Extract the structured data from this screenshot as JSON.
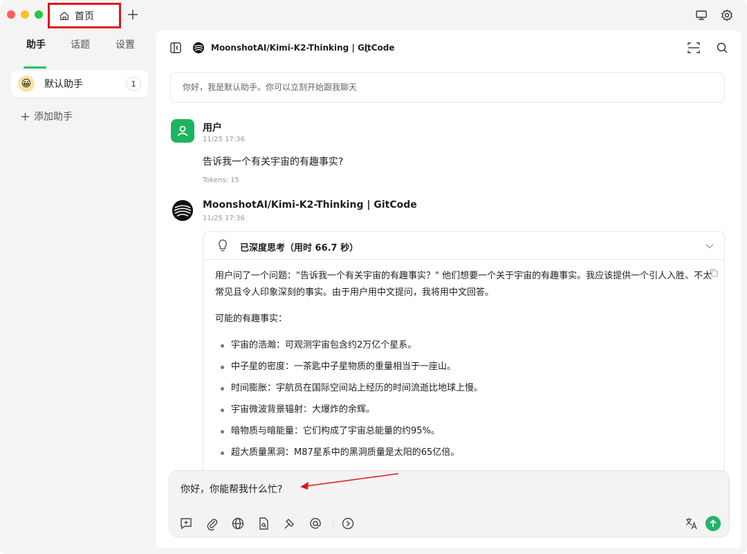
{
  "titlebar": {
    "tab_label": "首页",
    "icons": [
      "home-icon",
      "plus-icon",
      "monitor-icon",
      "gear-icon"
    ]
  },
  "sidebar": {
    "tabs": [
      {
        "label": "助手",
        "active": true
      },
      {
        "label": "话题",
        "active": false
      },
      {
        "label": "设置",
        "active": false
      }
    ],
    "assistant": {
      "emoji": "😀",
      "name": "默认助手",
      "count": "1"
    },
    "add_label": "添加助手"
  },
  "main": {
    "model_title": "MoonshotAI/Kimi-K2-Thinking | GitCode",
    "notice": "你好，我是默认助手。你可以立刻开始跟我聊天"
  },
  "messages": {
    "user": {
      "name": "用户",
      "time": "11/25 17:36",
      "text": "告诉我一个有关宇宙的有趣事实?",
      "tokens": "Tokens: 15"
    },
    "bot": {
      "name": "MoonshotAI/Kimi-K2-Thinking | GitCode",
      "time": "11/25 17:36",
      "thinking_title": "已深度思考（用时 66.7 秒）",
      "para1": "用户问了一个问题：\"告诉我一个有关宇宙的有趣事实？\" 他们想要一个关于宇宙的有趣事实。我应该提供一个引人入胜、不太常见且令人印象深刻的事实。由于用户用中文提问，我将用中文回答。",
      "para2": "可能的有趣事实：",
      "facts": [
        "宇宙的浩瀚：可观测宇宙包含约2万亿个星系。",
        "中子星的密度：一茶匙中子星物质的重量相当于一座山。",
        "时间膨胀：宇航员在国际空间站上经历的时间流逝比地球上慢。",
        "宇宙微波背景辐射：大爆炸的余辉。",
        "暗物质与暗能量：它们构成了宇宙总能量的约95%。",
        "超大质量黑洞：M87星系中的黑洞质量是太阳的65亿倍。"
      ]
    }
  },
  "input": {
    "text": "你好，你能帮我什么忙?"
  },
  "colors": {
    "accent": "#22c064",
    "annotation_red": "#e1141b",
    "send": "#22b46a"
  }
}
